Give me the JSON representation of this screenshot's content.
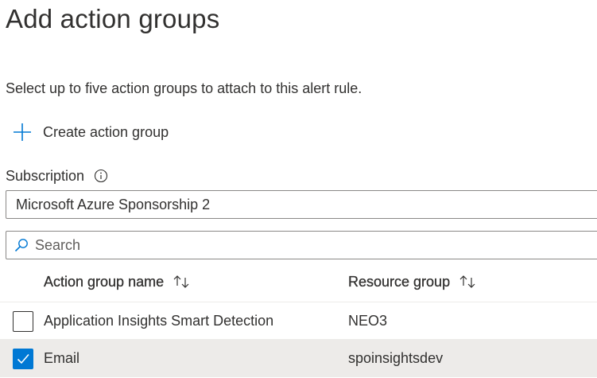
{
  "page": {
    "title": "Add action groups",
    "description": "Select up to five action groups to attach to this alert rule."
  },
  "create_action": {
    "label": "Create action group",
    "icon": "plus-icon"
  },
  "subscription": {
    "label": "Subscription",
    "info_icon": "info-icon",
    "value": "Microsoft Azure Sponsorship 2"
  },
  "search": {
    "placeholder": "Search",
    "icon": "search-icon"
  },
  "table": {
    "columns": [
      {
        "label": "Action group name",
        "sort_icon": "sort-arrows-icon"
      },
      {
        "label": "Resource group",
        "sort_icon": "sort-arrows-icon"
      }
    ],
    "rows": [
      {
        "name": "Application Insights Smart Detection",
        "resource_group": "NEO3",
        "checked": false
      },
      {
        "name": "Email",
        "resource_group": "spoinsightsdev",
        "checked": true
      }
    ]
  },
  "colors": {
    "accent": "#0078d4",
    "text": "#323130",
    "selected_row": "#edebe9",
    "border": "#8a8886"
  }
}
